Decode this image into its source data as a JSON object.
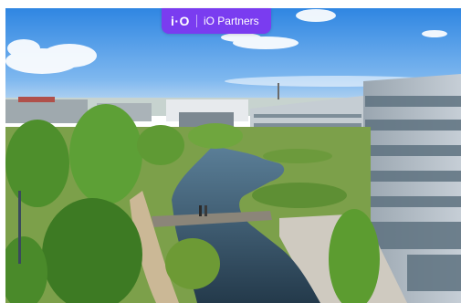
{
  "badge": {
    "logo": "i·O",
    "label": "iO Partners",
    "background": "#7a3cf0"
  },
  "photo": {
    "sky": "#3d8ee6",
    "foliage": "#4e8f2c",
    "water": "#31516b"
  }
}
